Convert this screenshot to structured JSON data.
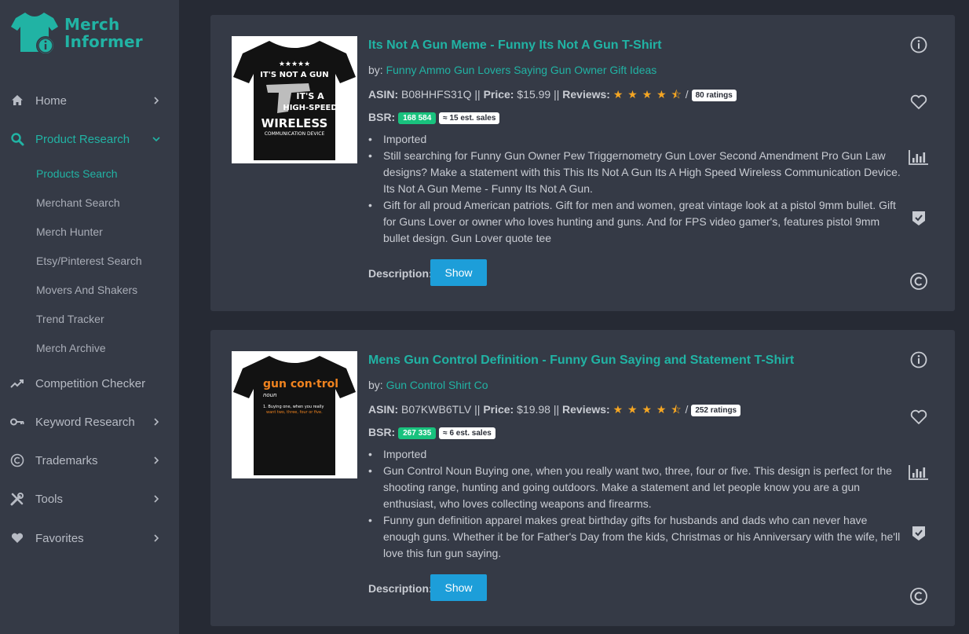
{
  "app": {
    "name_line1": "Merch",
    "name_line2": "Informer"
  },
  "colors": {
    "accent": "#21b3a4",
    "button": "#1d9ed9",
    "bsr_badge": "#19c27e",
    "star": "#f5a623",
    "sidebar_bg": "#353a46",
    "page_bg": "#262a34"
  },
  "sidebar": {
    "items": [
      {
        "label": "Home",
        "icon": "home-icon"
      },
      {
        "label": "Product Research",
        "icon": "search-icon"
      },
      {
        "label": "Competition Checker",
        "icon": "trend-icon"
      },
      {
        "label": "Keyword Research",
        "icon": "key-icon"
      },
      {
        "label": "Trademarks",
        "icon": "copyright-icon"
      },
      {
        "label": "Tools",
        "icon": "tools-icon"
      },
      {
        "label": "Favorites",
        "icon": "heart-icon"
      }
    ],
    "subitems": [
      {
        "label": "Products Search"
      },
      {
        "label": "Merchant Search"
      },
      {
        "label": "Merch Hunter"
      },
      {
        "label": "Etsy/Pinterest Search"
      },
      {
        "label": "Movers And Shakers"
      },
      {
        "label": "Trend Tracker"
      },
      {
        "label": "Merch Archive"
      }
    ]
  },
  "labels": {
    "by": "by:",
    "asin": "ASIN:",
    "price": "Price:",
    "reviews": "Reviews:",
    "bsr": "BSR:",
    "description": "Description:",
    "show": "Show",
    "separator": "||",
    "slash": "/"
  },
  "products": [
    {
      "title": "Its Not A Gun Meme - Funny Its Not A Gun T-Shirt",
      "brand": "Funny Ammo Gun Lovers Saying Gun Owner Gift Ideas",
      "asin": "B08HHFS31Q",
      "price": "$15.99",
      "rating": 4.5,
      "stars": "★ ★ ★ ★ ⯪",
      "ratings_count": "80 ratings",
      "bsr": "168 584",
      "est_sales": "≈ 15 est. sales",
      "bullets": [
        "Imported",
        "Still searching for Funny Gun Owner Pew Triggernometry Gun Lover Second Amendment Pro Gun Law designs? Make a statement with this This Its Not A Gun Its A High Speed Wireless Communication Device. Its Not A Gun Meme - Funny Its Not A Gun.",
        "Gift for all proud American patriots. Gift for men and women, great vintage look at a pistol 9mm bullet. Gift for Guns Lover or owner who loves hunting and guns. And for FPS video gamer's, features pistol 9mm bullet design. Gun Lover quote tee"
      ],
      "shirt_text": {
        "stars": "★★★★★",
        "l1": "IT'S NOT A GUN",
        "l2": "IT'S A",
        "l3": "HIGH-SPEED",
        "l4": "WIRELESS",
        "l5": "COMMUNICATION DEVICE"
      }
    },
    {
      "title": "Mens Gun Control Definition - Funny Gun Saying and Statement T-Shirt",
      "brand": "Gun Control Shirt Co",
      "asin": "B07KWB6TLV",
      "price": "$19.98",
      "rating": 4.5,
      "stars": "★ ★ ★ ★ ⯪",
      "ratings_count": "252 ratings",
      "bsr": "267 335",
      "est_sales": "≈ 6 est. sales",
      "bullets": [
        "Imported",
        "Gun Control Noun Buying one, when you really want two, three, four or five. This design is perfect for the shooting range, hunting and going outdoors. Make a statement and let people know you are a gun enthusiast, who loves collecting weapons and firearms.",
        "Funny gun definition apparel makes great birthday gifts for husbands and dads who can never have enough guns. Whether it be for Father's Day from the kids, Christmas or his Anniversary with the wife, he'll love this fun gun saying."
      ],
      "shirt_text": {
        "l1": "gun con·trol",
        "l2": "noun",
        "l3": "1. Buying one, when you really",
        "l4": "want two, three, four or five."
      }
    }
  ]
}
